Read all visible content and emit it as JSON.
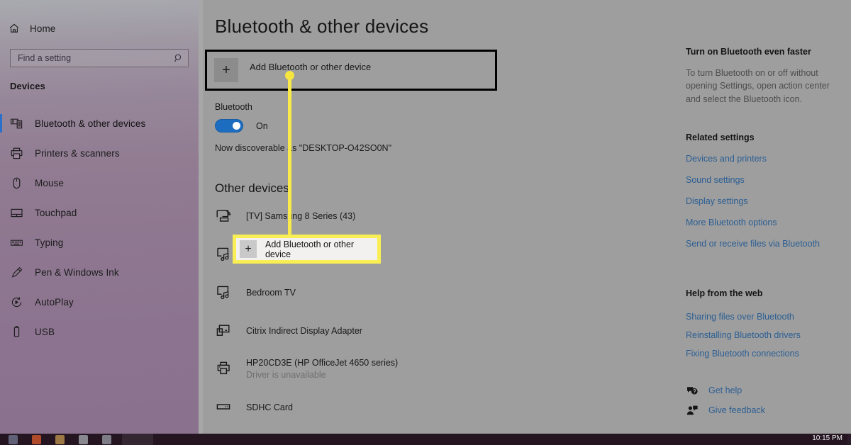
{
  "sidebar": {
    "home_label": "Home",
    "search": {
      "placeholder": "Find a setting",
      "value": ""
    },
    "section_title": "Devices",
    "items": [
      {
        "label": "Bluetooth & other devices",
        "icon": "bluetooth-devices-icon",
        "selected": true
      },
      {
        "label": "Printers & scanners",
        "icon": "printer-icon",
        "selected": false
      },
      {
        "label": "Mouse",
        "icon": "mouse-icon",
        "selected": false
      },
      {
        "label": "Touchpad",
        "icon": "touchpad-icon",
        "selected": false
      },
      {
        "label": "Typing",
        "icon": "keyboard-icon",
        "selected": false
      },
      {
        "label": "Pen & Windows Ink",
        "icon": "pen-icon",
        "selected": false
      },
      {
        "label": "AutoPlay",
        "icon": "autoplay-icon",
        "selected": false
      },
      {
        "label": "USB",
        "icon": "usb-icon",
        "selected": false
      }
    ],
    "accent_color": "#2a6fc9"
  },
  "main": {
    "page_title": "Bluetooth & other devices",
    "add_device": {
      "label": "Add Bluetooth or other device",
      "icon": "plus-icon"
    },
    "bluetooth": {
      "heading": "Bluetooth",
      "state_label": "On",
      "toggle_on": true,
      "toggle_color": "#1c6cc0",
      "discoverable_text": "Now discoverable as \"DESKTOP-O42SO0N\""
    },
    "other_devices": {
      "heading": "Other devices",
      "devices": [
        {
          "name": "[TV] Samsung 8 Series (43)",
          "status": "",
          "icon": "cast-display-icon"
        },
        {
          "name": "",
          "status": "",
          "icon": "media-audio-device-icon"
        },
        {
          "name": "Bedroom TV",
          "status": "",
          "icon": "media-audio-device-icon"
        },
        {
          "name": "Citrix Indirect Display Adapter",
          "status": "",
          "icon": "display-adapter-icon"
        },
        {
          "name": "HP20CD3E (HP OfficeJet 4650 series)",
          "status": "Driver is unavailable",
          "icon": "printer-icon"
        },
        {
          "name": "SDHC Card",
          "status": "",
          "icon": "sd-card-icon"
        }
      ]
    }
  },
  "rail": {
    "tip_heading": "Turn on Bluetooth even faster",
    "tip_body": "To turn Bluetooth on or off without opening Settings, open action center and select the Bluetooth icon.",
    "related_heading": "Related settings",
    "related_links": [
      "Devices and printers",
      "Sound settings",
      "Display settings",
      "More Bluetooth options",
      "Send or receive files via Bluetooth"
    ],
    "help_heading": "Help from the web",
    "help_links": [
      "Sharing files over Bluetooth",
      "Reinstalling Bluetooth drivers",
      "Fixing Bluetooth connections"
    ],
    "support": [
      {
        "label": "Get help",
        "icon": "help-bubble-icon"
      },
      {
        "label": "Give feedback",
        "icon": "feedback-person-icon"
      }
    ],
    "link_color": "#2b5e93"
  },
  "annotation": {
    "callout_label": "Add Bluetooth or other device",
    "callout_icon": "plus-icon",
    "highlight_color": "#f7e53f"
  },
  "taskbar": {
    "clock": "10:15 PM"
  }
}
